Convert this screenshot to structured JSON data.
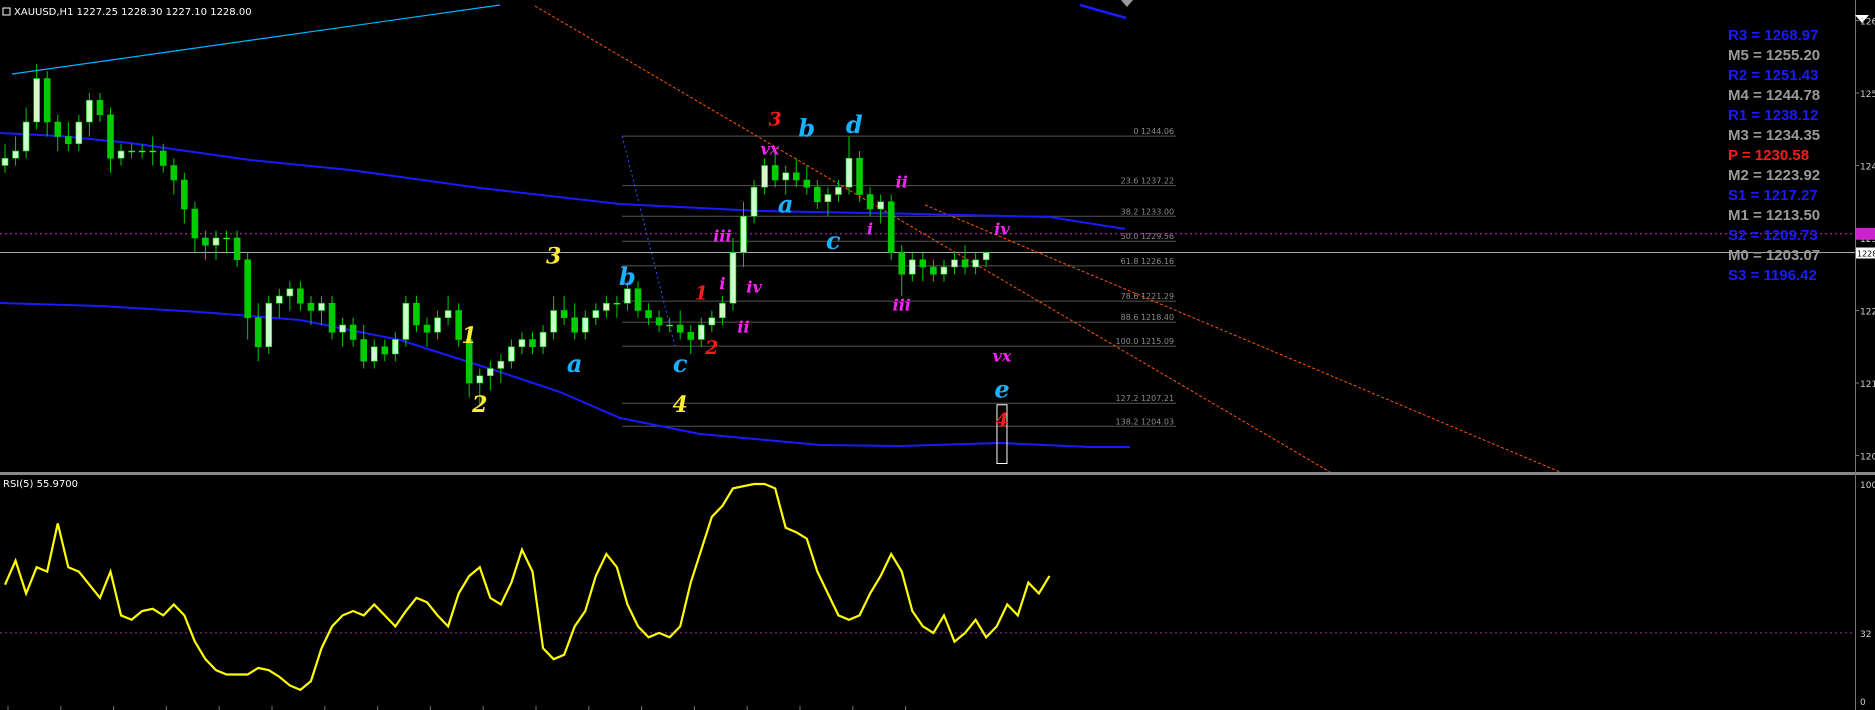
{
  "header": {
    "symbol_info": "XAUUSD,H1  1227.25 1228.30 1227.10 1228.00",
    "rsi_label": "RSI(5) 55.9700"
  },
  "colors": {
    "background": "#000000",
    "bull_candle": "#ccffcc",
    "bear_candle": "#00cc00",
    "ma_line": "#1a1aff",
    "trend_line": "#00b4ff",
    "channel": "#ff5500",
    "rsi_line": "#ffff00",
    "fib_line": "#555555",
    "yellow_wave": "#ffee33",
    "red_wave": "#ff1a1a",
    "magenta_wave": "#ff22ff",
    "cyan_wave": "#1ab2ff"
  },
  "chart_data": [
    {
      "type": "candlestick",
      "title": "XAUUSD,H1",
      "ylim": [
        1198,
        1262
      ],
      "y_ticks": [
        "126",
        "125",
        "124",
        "123",
        "122",
        "121",
        "120"
      ],
      "price_marker": "1228",
      "pivots": [
        {
          "label": "R3 = 1268.97",
          "color": "#1a1aff"
        },
        {
          "label": "M5 = 1255.20",
          "color": "#9a9a9a"
        },
        {
          "label": "R2 = 1251.43",
          "color": "#1a1aff"
        },
        {
          "label": "M4 = 1244.78",
          "color": "#9a9a9a"
        },
        {
          "label": "R1 = 1238.12",
          "color": "#1a1aff"
        },
        {
          "label": "M3 = 1234.35",
          "color": "#9a9a9a"
        },
        {
          "label": "P   = 1230.58",
          "color": "#ff1a1a"
        },
        {
          "label": "M2 = 1223.92",
          "color": "#9a9a9a"
        },
        {
          "label": "S1 = 1217.27",
          "color": "#1a1aff"
        },
        {
          "label": "M1 = 1213.50",
          "color": "#9a9a9a"
        },
        {
          "label": "S2 = 1209.73",
          "color": "#1a1aff"
        },
        {
          "label": "M0 = 1203.07",
          "color": "#9a9a9a"
        },
        {
          "label": "S3 = 1196.42",
          "color": "#1a1aff"
        }
      ],
      "fib_levels": [
        {
          "label": "0 1244.06",
          "value": 1244.06
        },
        {
          "label": "23.6 1237.22",
          "value": 1237.22
        },
        {
          "label": "38.2 1233.00",
          "value": 1233.0
        },
        {
          "label": "50.0 1229.56",
          "value": 1229.56
        },
        {
          "label": "61.8 1226.16",
          "value": 1226.16
        },
        {
          "label": "78.6 1221.29",
          "value": 1221.29
        },
        {
          "label": "88.6 1218.40",
          "value": 1218.4
        },
        {
          "label": "100.0 1215.09",
          "value": 1215.09
        },
        {
          "label": "127.2 1207.21",
          "value": 1207.21
        },
        {
          "label": "138.2 1204.03",
          "value": 1204.03
        }
      ],
      "wave_labels": [
        {
          "text": "1",
          "bar": 44,
          "price": 1215.5,
          "color": "yellow"
        },
        {
          "text": "2",
          "bar": 45,
          "price": 1206,
          "color": "yellow"
        },
        {
          "text": "3",
          "bar": 52,
          "price": 1226.5,
          "color": "yellow"
        },
        {
          "text": "4",
          "bar": 64,
          "price": 1206,
          "color": "yellow"
        },
        {
          "text": "a",
          "bar": 54,
          "price": 1211.5,
          "color": "cyan"
        },
        {
          "text": "b",
          "bar": 59,
          "price": 1223.5,
          "color": "cyan"
        },
        {
          "text": "c",
          "bar": 64,
          "price": 1211.5,
          "color": "cyan"
        },
        {
          "text": "1",
          "bar": 66,
          "price": 1221.5,
          "color": "red"
        },
        {
          "text": "2",
          "bar": 67,
          "price": 1214,
          "color": "red"
        },
        {
          "text": "i",
          "bar": 68,
          "price": 1223,
          "color": "magenta"
        },
        {
          "text": "ii",
          "bar": 70,
          "price": 1217,
          "color": "magenta"
        },
        {
          "text": "iii",
          "bar": 68,
          "price": 1229.5,
          "color": "magenta"
        },
        {
          "text": "iv",
          "bar": 71,
          "price": 1222.5,
          "color": "magenta"
        },
        {
          "text": "3",
          "bar": 73,
          "price": 1245.5,
          "color": "red"
        },
        {
          "text": "vx",
          "bar": 72.5,
          "price": 1241.5,
          "color": "magenta"
        },
        {
          "text": "b",
          "bar": 76,
          "price": 1244,
          "color": "cyan"
        },
        {
          "text": "a",
          "bar": 74,
          "price": 1233.5,
          "color": "cyan"
        },
        {
          "text": "c",
          "bar": 78.5,
          "price": 1228.5,
          "color": "cyan"
        },
        {
          "text": "d",
          "bar": 80.5,
          "price": 1244.5,
          "color": "cyan"
        },
        {
          "text": "ii",
          "bar": 85,
          "price": 1237,
          "color": "magenta"
        },
        {
          "text": "i",
          "bar": 82,
          "price": 1230.5,
          "color": "magenta"
        },
        {
          "text": "iii",
          "bar": 85,
          "price": 1220,
          "color": "magenta"
        },
        {
          "text": "iv",
          "bar": 94.5,
          "price": 1230.5,
          "color": "magenta"
        },
        {
          "text": "vx",
          "bar": 94.5,
          "price": 1213,
          "color": "magenta"
        },
        {
          "text": "e",
          "bar": 94.5,
          "price": 1208,
          "color": "cyan"
        },
        {
          "text": "4",
          "bar": 94.5,
          "price": 1204,
          "color": "red"
        }
      ],
      "candles": [
        [
          1240,
          1243,
          1239,
          1241
        ],
        [
          1241,
          1244,
          1240,
          1242
        ],
        [
          1242,
          1248,
          1241,
          1246
        ],
        [
          1246,
          1254,
          1245,
          1252
        ],
        [
          1252,
          1253,
          1244,
          1246
        ],
        [
          1246,
          1247,
          1242,
          1244
        ],
        [
          1244,
          1246,
          1242,
          1243
        ],
        [
          1243,
          1247,
          1242,
          1246
        ],
        [
          1246,
          1250,
          1244,
          1249
        ],
        [
          1249,
          1250,
          1246,
          1247
        ],
        [
          1247,
          1248,
          1239,
          1241
        ],
        [
          1241,
          1243,
          1240,
          1242
        ],
        [
          1242,
          1243,
          1241,
          1242
        ],
        [
          1242,
          1243,
          1241,
          1242
        ],
        [
          1242,
          1244,
          1240,
          1242
        ],
        [
          1242,
          1243,
          1239,
          1240
        ],
        [
          1240,
          1241,
          1236,
          1238
        ],
        [
          1238,
          1239,
          1232,
          1234
        ],
        [
          1234,
          1235,
          1228,
          1230
        ],
        [
          1230,
          1231,
          1227,
          1229
        ],
        [
          1229,
          1231,
          1227,
          1230
        ],
        [
          1230,
          1231,
          1228,
          1230
        ],
        [
          1230,
          1231,
          1226,
          1227
        ],
        [
          1227,
          1228,
          1216,
          1219
        ],
        [
          1219,
          1221,
          1213,
          1215
        ],
        [
          1215,
          1222,
          1214,
          1221
        ],
        [
          1221,
          1223,
          1219,
          1222
        ],
        [
          1222,
          1224,
          1220,
          1223
        ],
        [
          1223,
          1224,
          1220,
          1221
        ],
        [
          1221,
          1222,
          1218,
          1220
        ],
        [
          1220,
          1222,
          1218,
          1221
        ],
        [
          1221,
          1222,
          1216,
          1217
        ],
        [
          1217,
          1219,
          1215,
          1218
        ],
        [
          1218,
          1219,
          1215,
          1216
        ],
        [
          1216,
          1218,
          1212,
          1213
        ],
        [
          1213,
          1216,
          1212,
          1215
        ],
        [
          1215,
          1216,
          1213,
          1214
        ],
        [
          1214,
          1217,
          1213,
          1216
        ],
        [
          1216,
          1222,
          1215,
          1221
        ],
        [
          1221,
          1222,
          1217,
          1218
        ],
        [
          1218,
          1219,
          1215,
          1217
        ],
        [
          1217,
          1220,
          1216,
          1219
        ],
        [
          1219,
          1222,
          1218,
          1220
        ],
        [
          1220,
          1221,
          1215,
          1216
        ],
        [
          1216,
          1217,
          1208,
          1210
        ],
        [
          1210,
          1212,
          1207,
          1211
        ],
        [
          1211,
          1213,
          1209,
          1212
        ],
        [
          1212,
          1214,
          1210,
          1213
        ],
        [
          1213,
          1216,
          1212,
          1215
        ],
        [
          1215,
          1217,
          1214,
          1216
        ],
        [
          1216,
          1217,
          1214,
          1215
        ],
        [
          1215,
          1218,
          1214,
          1217
        ],
        [
          1217,
          1222,
          1216,
          1220
        ],
        [
          1220,
          1222,
          1218,
          1219
        ],
        [
          1219,
          1221,
          1216,
          1217
        ],
        [
          1217,
          1220,
          1216,
          1219
        ],
        [
          1219,
          1221,
          1218,
          1220
        ],
        [
          1220,
          1222,
          1219,
          1221
        ],
        [
          1221,
          1222,
          1219,
          1221
        ],
        [
          1221,
          1224,
          1220,
          1223
        ],
        [
          1223,
          1224,
          1219,
          1220
        ],
        [
          1220,
          1221,
          1218,
          1219
        ],
        [
          1219,
          1220,
          1217,
          1218
        ],
        [
          1218,
          1219,
          1217,
          1218
        ],
        [
          1218,
          1220,
          1216,
          1217
        ],
        [
          1217,
          1218,
          1214,
          1216
        ],
        [
          1216,
          1219,
          1215,
          1218
        ],
        [
          1218,
          1220,
          1217,
          1219
        ],
        [
          1219,
          1222,
          1218,
          1221
        ],
        [
          1221,
          1230,
          1220,
          1228
        ],
        [
          1228,
          1235,
          1226,
          1233
        ],
        [
          1233,
          1238,
          1232,
          1237
        ],
        [
          1237,
          1241,
          1236,
          1240
        ],
        [
          1240,
          1242,
          1237,
          1238
        ],
        [
          1238,
          1240,
          1236,
          1239
        ],
        [
          1239,
          1241,
          1237,
          1238
        ],
        [
          1238,
          1240,
          1236,
          1237
        ],
        [
          1237,
          1238,
          1234,
          1235
        ],
        [
          1235,
          1237,
          1233,
          1236
        ],
        [
          1236,
          1238,
          1235,
          1237
        ],
        [
          1237,
          1244,
          1236,
          1241
        ],
        [
          1241,
          1242,
          1235,
          1236
        ],
        [
          1236,
          1237,
          1233,
          1234
        ],
        [
          1234,
          1236,
          1232,
          1235
        ],
        [
          1235,
          1236,
          1227,
          1228
        ],
        [
          1228,
          1229,
          1222,
          1225
        ],
        [
          1225,
          1228,
          1224,
          1227
        ],
        [
          1227,
          1228,
          1224,
          1226
        ],
        [
          1226,
          1227,
          1224,
          1225
        ],
        [
          1225,
          1227,
          1224,
          1226
        ],
        [
          1226,
          1228,
          1225,
          1227
        ],
        [
          1227,
          1229,
          1225,
          1226
        ],
        [
          1226,
          1228,
          1225,
          1227
        ],
        [
          1227,
          1228,
          1226,
          1228
        ]
      ]
    },
    {
      "type": "line",
      "title": "RSI(5) 55.9700",
      "ylim": [
        0,
        100
      ],
      "y_ticks": [
        "100",
        "32",
        "0"
      ],
      "levels": [
        32
      ],
      "series": [
        {
          "values": [
            54,
            65,
            50,
            62,
            60,
            82,
            62,
            60,
            54,
            48,
            60,
            40,
            38,
            42,
            43,
            40,
            45,
            40,
            28,
            20,
            15,
            13,
            13,
            13,
            16,
            15,
            12,
            8,
            6,
            10,
            25,
            35,
            40,
            42,
            40,
            45,
            40,
            35,
            42,
            48,
            46,
            40,
            35,
            50,
            58,
            62,
            48,
            45,
            55,
            70,
            60,
            25,
            20,
            22,
            35,
            42,
            58,
            68,
            62,
            45,
            35,
            30,
            32,
            30,
            35,
            55,
            70,
            85,
            90,
            98,
            99,
            100,
            100,
            98,
            80,
            78,
            75,
            60,
            50,
            40,
            38,
            40,
            50,
            58,
            68,
            60,
            42,
            35,
            32,
            40,
            28,
            32,
            38,
            30,
            35,
            45,
            40,
            55,
            50,
            58
          ]
        }
      ]
    }
  ]
}
